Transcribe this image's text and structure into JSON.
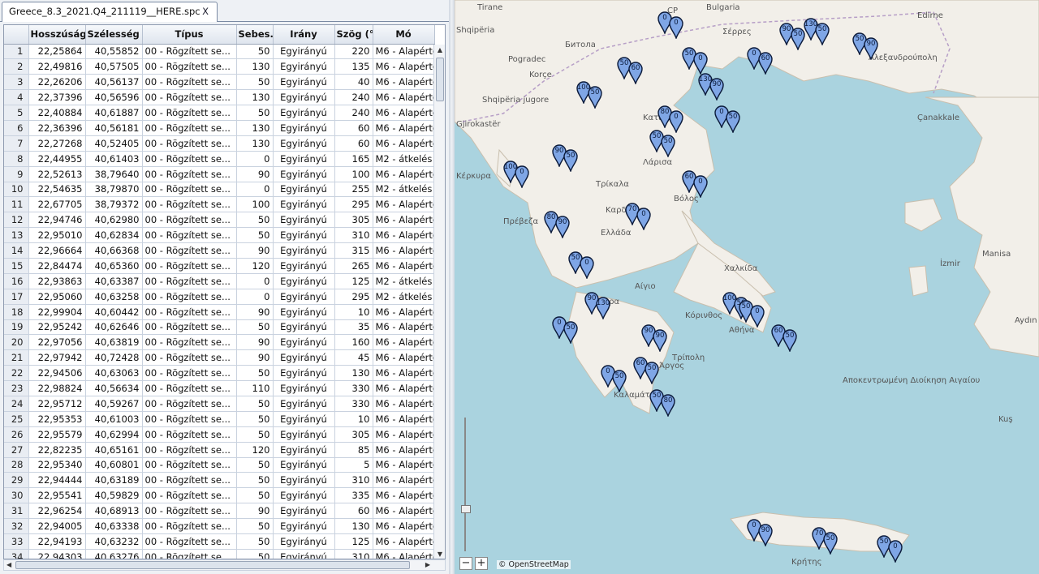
{
  "tab": {
    "title": "Greece_8.3_2021.Q4_211119__HERE.spc",
    "close": "X"
  },
  "columns": [
    "",
    "Hosszúság...",
    "Szélesség ...",
    "Típus",
    "Sebes...",
    "Irány",
    "Szög (°)",
    "Mó"
  ],
  "rows": [
    [
      "1",
      "22,25864",
      "40,55852",
      "00 - Rögzített se...",
      "50",
      "Egyirányú",
      "220",
      "M6 - Alapérte"
    ],
    [
      "2",
      "22,49816",
      "40,57505",
      "00 - Rögzített se...",
      "130",
      "Egyirányú",
      "135",
      "M6 - Alapérte"
    ],
    [
      "3",
      "22,26206",
      "40,56137",
      "00 - Rögzített se...",
      "50",
      "Egyirányú",
      "40",
      "M6 - Alapérte"
    ],
    [
      "4",
      "22,37396",
      "40,56596",
      "00 - Rögzített se...",
      "130",
      "Egyirányú",
      "240",
      "M6 - Alapérte"
    ],
    [
      "5",
      "22,40884",
      "40,61887",
      "00 - Rögzített se...",
      "50",
      "Egyirányú",
      "240",
      "M6 - Alapérte"
    ],
    [
      "6",
      "22,36396",
      "40,56181",
      "00 - Rögzített se...",
      "130",
      "Egyirányú",
      "60",
      "M6 - Alapérte"
    ],
    [
      "7",
      "22,27268",
      "40,52405",
      "00 - Rögzített se...",
      "130",
      "Egyirányú",
      "60",
      "M6 - Alapérte"
    ],
    [
      "8",
      "22,44955",
      "40,61403",
      "00 - Rögzített se...",
      "0",
      "Egyirányú",
      "165",
      "M2 - átkelés"
    ],
    [
      "9",
      "22,52613",
      "38,79640",
      "00 - Rögzített se...",
      "90",
      "Egyirányú",
      "100",
      "M6 - Alapérte"
    ],
    [
      "10",
      "22,54635",
      "38,79870",
      "00 - Rögzített se...",
      "0",
      "Egyirányú",
      "255",
      "M2 - átkelés"
    ],
    [
      "11",
      "22,67705",
      "38,79372",
      "00 - Rögzített se...",
      "100",
      "Egyirányú",
      "295",
      "M6 - Alapérte"
    ],
    [
      "12",
      "22,94746",
      "40,62980",
      "00 - Rögzített se...",
      "50",
      "Egyirányú",
      "305",
      "M6 - Alapérte"
    ],
    [
      "13",
      "22,95010",
      "40,62834",
      "00 - Rögzített se...",
      "50",
      "Egyirányú",
      "310",
      "M6 - Alapérte"
    ],
    [
      "14",
      "22,96664",
      "40,66368",
      "00 - Rögzített se...",
      "90",
      "Egyirányú",
      "315",
      "M6 - Alapérte"
    ],
    [
      "15",
      "22,84474",
      "40,65360",
      "00 - Rögzített se...",
      "120",
      "Egyirányú",
      "265",
      "M6 - Alapérte"
    ],
    [
      "16",
      "22,93863",
      "40,63387",
      "00 - Rögzített se...",
      "0",
      "Egyirányú",
      "125",
      "M2 - átkelés"
    ],
    [
      "17",
      "22,95060",
      "40,63258",
      "00 - Rögzített se...",
      "0",
      "Egyirányú",
      "295",
      "M2 - átkelés"
    ],
    [
      "18",
      "22,99904",
      "40,60442",
      "00 - Rögzített se...",
      "90",
      "Egyirányú",
      "10",
      "M6 - Alapérte"
    ],
    [
      "19",
      "22,95242",
      "40,62646",
      "00 - Rögzített se...",
      "50",
      "Egyirányú",
      "35",
      "M6 - Alapérte"
    ],
    [
      "20",
      "22,97056",
      "40,63819",
      "00 - Rögzített se...",
      "90",
      "Egyirányú",
      "160",
      "M6 - Alapérte"
    ],
    [
      "21",
      "22,97942",
      "40,72428",
      "00 - Rögzített se...",
      "90",
      "Egyirányú",
      "45",
      "M6 - Alapérte"
    ],
    [
      "22",
      "22,94506",
      "40,63063",
      "00 - Rögzített se...",
      "50",
      "Egyirányú",
      "130",
      "M6 - Alapérte"
    ],
    [
      "23",
      "22,98824",
      "40,56634",
      "00 - Rögzített se...",
      "110",
      "Egyirányú",
      "330",
      "M6 - Alapérte"
    ],
    [
      "24",
      "22,95712",
      "40,59267",
      "00 - Rögzített se...",
      "50",
      "Egyirányú",
      "330",
      "M6 - Alapérte"
    ],
    [
      "25",
      "22,95353",
      "40,61003",
      "00 - Rögzített se...",
      "50",
      "Egyirányú",
      "10",
      "M6 - Alapérte"
    ],
    [
      "26",
      "22,95579",
      "40,62994",
      "00 - Rögzített se...",
      "50",
      "Egyirányú",
      "305",
      "M6 - Alapérte"
    ],
    [
      "27",
      "22,82235",
      "40,65161",
      "00 - Rögzített se...",
      "120",
      "Egyirányú",
      "85",
      "M6 - Alapérte"
    ],
    [
      "28",
      "22,95340",
      "40,60801",
      "00 - Rögzített se...",
      "50",
      "Egyirányú",
      "5",
      "M6 - Alapérte"
    ],
    [
      "29",
      "22,94444",
      "40,63189",
      "00 - Rögzített se...",
      "50",
      "Egyirányú",
      "310",
      "M6 - Alapérte"
    ],
    [
      "30",
      "22,95541",
      "40,59829",
      "00 - Rögzített se...",
      "50",
      "Egyirányú",
      "335",
      "M6 - Alapérte"
    ],
    [
      "31",
      "22,96254",
      "40,68913",
      "00 - Rögzített se...",
      "90",
      "Egyirányú",
      "60",
      "M6 - Alapérte"
    ],
    [
      "32",
      "22,94005",
      "40,63338",
      "00 - Rögzített se...",
      "50",
      "Egyirányú",
      "130",
      "M6 - Alapérte"
    ],
    [
      "33",
      "22,94193",
      "40,63232",
      "00 - Rögzített se...",
      "50",
      "Egyirányú",
      "125",
      "M6 - Alapérte"
    ],
    [
      "34",
      "22,94303",
      "40,63276",
      "00 - Rögzített se...",
      "50",
      "Egyirányú",
      "310",
      "M6 - Alapérte"
    ]
  ],
  "map": {
    "attribution": "© OpenStreetMap",
    "zoom_in": "+",
    "zoom_out": "−",
    "labels": [
      "Tirane",
      "Shqipëria",
      "Битола",
      "Pogradec",
      "Korçe",
      "Shqipëria jugore",
      "Gjirokastër",
      "Κέρκυρα",
      "Σέρρες",
      "Edirne",
      "Αλεξανδρούπολη",
      "Κατερίνη",
      "Λάρισα",
      "Τρίκαλα",
      "Καρδίτσα",
      "Βόλος",
      "Ελλάδα",
      "Πρέβεζα",
      "Χαλκίδα",
      "Πάτρα",
      "Αίγιο",
      "Κόρινθος",
      "Αθήνα",
      "Άργος",
      "Τρίπολη",
      "Καλαμάτα",
      "Çanakkale",
      "İzmir",
      "Manisa",
      "Aydın",
      "Kuş",
      "Αποκεντρωμένη Διοίκηση Αιγαίου",
      "Κρήτης",
      "Bulgaria",
      "CP"
    ]
  },
  "markers": [
    [
      "0",
      "0"
    ],
    [
      "90",
      "50"
    ],
    [
      "130",
      "50"
    ],
    [
      "50",
      "90"
    ],
    [
      "0",
      "60"
    ],
    [
      "50",
      "0"
    ],
    [
      "130",
      "90"
    ],
    [
      "100",
      "50"
    ],
    [
      "50",
      "60"
    ],
    [
      "0",
      "50"
    ],
    [
      "90",
      "50"
    ],
    [
      "100",
      "0"
    ],
    [
      "50",
      "50"
    ],
    [
      "70",
      "0"
    ],
    [
      "80",
      "90"
    ],
    [
      "60",
      "0"
    ],
    [
      "50",
      "0"
    ],
    [
      "90",
      "130"
    ],
    [
      "0",
      "50"
    ],
    [
      "100",
      "50"
    ],
    [
      "50",
      "0"
    ],
    [
      "90",
      "90"
    ],
    [
      "60",
      "50"
    ],
    [
      "0",
      "50"
    ],
    [
      "50",
      "80"
    ],
    [
      "80",
      "0"
    ],
    [
      "60",
      "50"
    ],
    [
      "0",
      "90"
    ],
    [
      "70",
      "50"
    ],
    [
      "50",
      "0"
    ]
  ]
}
